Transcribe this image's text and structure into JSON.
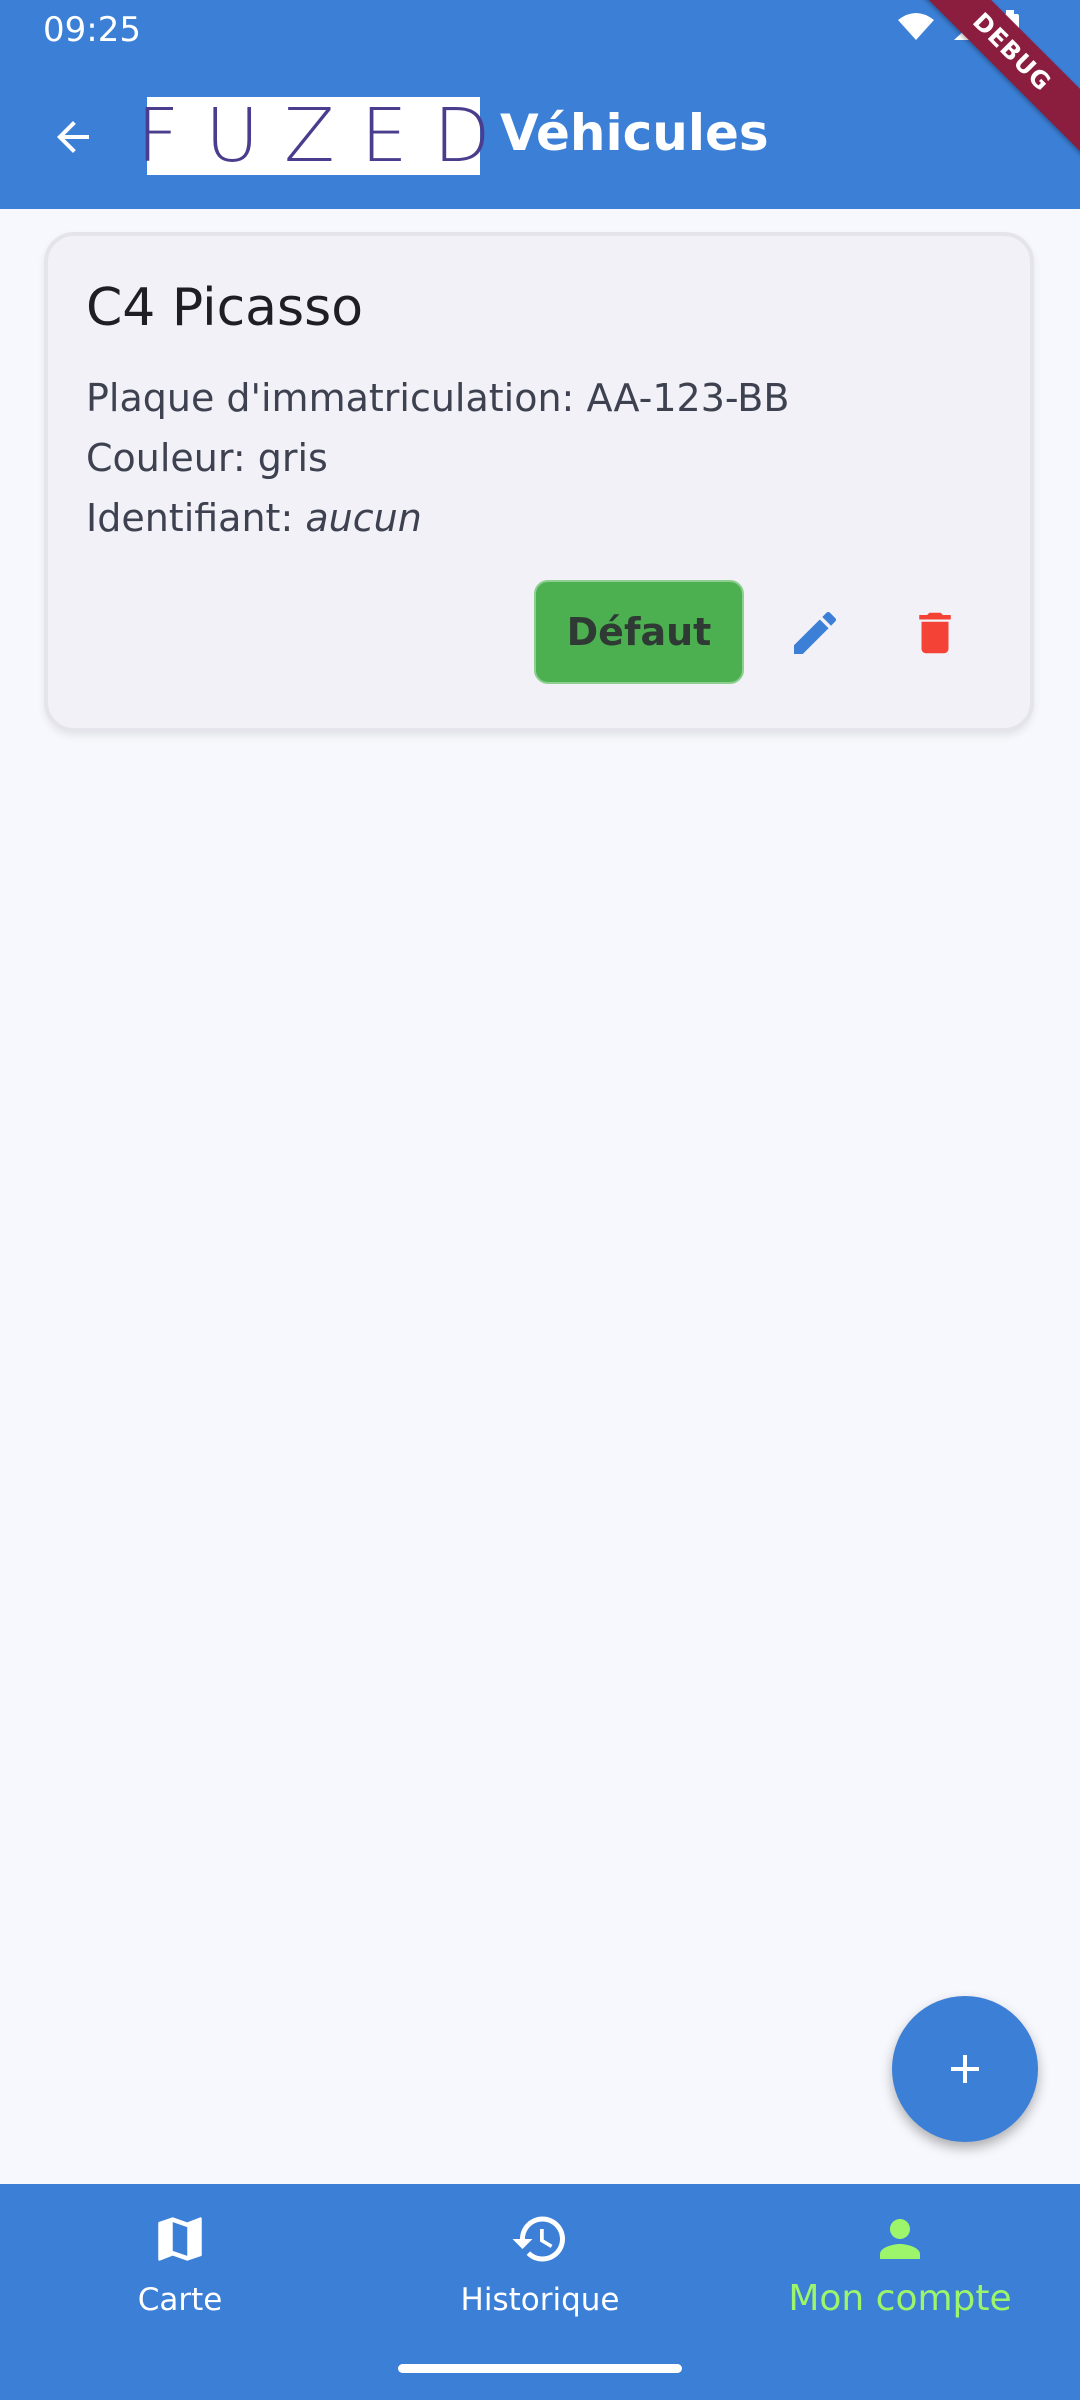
{
  "status_bar": {
    "time": "09:25"
  },
  "debug_banner": "DEBUG",
  "header": {
    "logo_text": "FUZED",
    "title": "Véhicules"
  },
  "vehicle": {
    "name": "C4 Picasso",
    "plate_line": "Plaque d'immatriculation: AA-123-BB",
    "color_line": "Couleur: gris",
    "id_label": "Identifiant: ",
    "id_value": "aucun",
    "default_button": "Défaut"
  },
  "bottom_nav": {
    "items": [
      {
        "label": "Carte",
        "icon": "map-icon"
      },
      {
        "label": "Historique",
        "icon": "history-icon"
      },
      {
        "label": "Mon compte",
        "icon": "person-icon",
        "active": true
      }
    ]
  },
  "colors": {
    "primary": "#3b7fd6",
    "active_nav": "#9cf56a",
    "default_button": "#4caf50",
    "delete": "#f44336",
    "logo": "#4b3d8d"
  }
}
